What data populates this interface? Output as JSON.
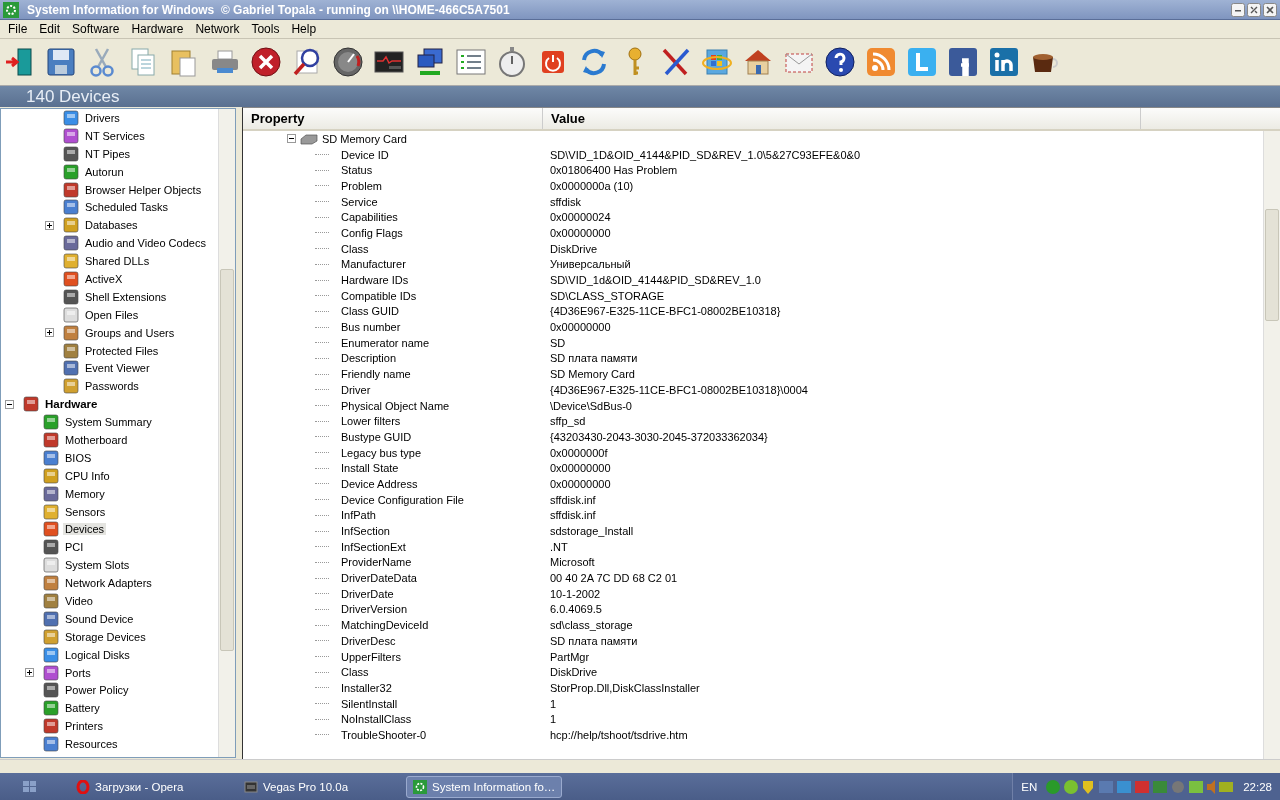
{
  "window": {
    "title": "System Information for Windows  © Gabriel Topala - running on \\\\HOME-466C5A7501"
  },
  "menu": [
    "File",
    "Edit",
    "Software",
    "Hardware",
    "Network",
    "Tools",
    "Help"
  ],
  "header": "140 Devices",
  "sidebar": {
    "items_above": [
      {
        "label": "Drivers",
        "kind": "leaf",
        "selected": false
      },
      {
        "label": "NT Services",
        "kind": "leaf",
        "selected": false
      },
      {
        "label": "NT Pipes",
        "kind": "leaf",
        "selected": false
      },
      {
        "label": "Autorun",
        "kind": "leaf",
        "selected": false
      },
      {
        "label": "Browser Helper Objects",
        "kind": "leaf",
        "selected": false
      },
      {
        "label": "Scheduled Tasks",
        "kind": "leaf",
        "selected": false
      },
      {
        "label": "Databases",
        "kind": "branch",
        "expanded": false,
        "selected": false
      },
      {
        "label": "Audio and Video Codecs",
        "kind": "leaf",
        "selected": false
      },
      {
        "label": "Shared DLLs",
        "kind": "leaf",
        "selected": false
      },
      {
        "label": "ActiveX",
        "kind": "leaf",
        "selected": false
      },
      {
        "label": "Shell Extensions",
        "kind": "leaf",
        "selected": false
      },
      {
        "label": "Open Files",
        "kind": "leaf",
        "selected": false
      },
      {
        "label": "Groups and Users",
        "kind": "branch",
        "expanded": false,
        "selected": false
      },
      {
        "label": "Protected Files",
        "kind": "leaf",
        "selected": false
      },
      {
        "label": "Event Viewer",
        "kind": "leaf",
        "selected": false
      },
      {
        "label": "Passwords",
        "kind": "leaf",
        "selected": false
      }
    ],
    "nodes": [
      {
        "label": "Hardware",
        "kind": "branch",
        "expanded": true,
        "selected": false,
        "children": [
          {
            "label": "System Summary",
            "kind": "leaf",
            "selected": false
          },
          {
            "label": "Motherboard",
            "kind": "leaf",
            "selected": false
          },
          {
            "label": "BIOS",
            "kind": "leaf",
            "selected": false
          },
          {
            "label": "CPU Info",
            "kind": "leaf",
            "selected": false
          },
          {
            "label": "Memory",
            "kind": "leaf",
            "selected": false
          },
          {
            "label": "Sensors",
            "kind": "leaf",
            "selected": false
          },
          {
            "label": "Devices",
            "kind": "leaf",
            "selected": true
          },
          {
            "label": "PCI",
            "kind": "leaf",
            "selected": false
          },
          {
            "label": "System Slots",
            "kind": "leaf",
            "selected": false
          },
          {
            "label": "Network Adapters",
            "kind": "leaf",
            "selected": false
          },
          {
            "label": "Video",
            "kind": "leaf",
            "selected": false
          },
          {
            "label": "Sound Device",
            "kind": "leaf",
            "selected": false
          },
          {
            "label": "Storage Devices",
            "kind": "leaf",
            "selected": false
          },
          {
            "label": "Logical Disks",
            "kind": "leaf",
            "selected": false
          },
          {
            "label": "Ports",
            "kind": "branch",
            "expanded": false,
            "selected": false
          },
          {
            "label": "Power Policy",
            "kind": "leaf",
            "selected": false
          },
          {
            "label": "Battery",
            "kind": "leaf",
            "selected": false
          },
          {
            "label": "Printers",
            "kind": "leaf",
            "selected": false
          },
          {
            "label": "Resources",
            "kind": "leaf",
            "selected": false
          }
        ]
      }
    ]
  },
  "table": {
    "columns": [
      "Property",
      "Value"
    ],
    "group": {
      "label": "SD Memory Card",
      "expanded": true,
      "rows": [
        {
          "property": "Device ID",
          "value": "SD\\VID_1D&OID_4144&PID_SD&REV_1.0\\5&27C93EFE&0&0"
        },
        {
          "property": "Status",
          "value": "0x01806400 Has Problem"
        },
        {
          "property": "Problem",
          "value": "0x0000000a (10)"
        },
        {
          "property": "Service",
          "value": "sffdisk"
        },
        {
          "property": "Capabilities",
          "value": "0x00000024"
        },
        {
          "property": "Config Flags",
          "value": "0x00000000"
        },
        {
          "property": "Class",
          "value": "DiskDrive"
        },
        {
          "property": "Manufacturer",
          "value": "Универсальный"
        },
        {
          "property": "Hardware IDs",
          "value": "SD\\VID_1d&OID_4144&PID_SD&REV_1.0"
        },
        {
          "property": "Compatible IDs",
          "value": "SD\\CLASS_STORAGE"
        },
        {
          "property": "Class GUID",
          "value": "{4D36E967-E325-11CE-BFC1-08002BE10318}"
        },
        {
          "property": "Bus number",
          "value": "0x00000000"
        },
        {
          "property": "Enumerator name",
          "value": "SD"
        },
        {
          "property": "Description",
          "value": "SD плата памяти"
        },
        {
          "property": "Friendly name",
          "value": "SD Memory Card"
        },
        {
          "property": "Driver",
          "value": "{4D36E967-E325-11CE-BFC1-08002BE10318}\\0004"
        },
        {
          "property": "Physical Object Name",
          "value": "\\Device\\SdBus-0"
        },
        {
          "property": "Lower filters",
          "value": "sffp_sd"
        },
        {
          "property": "Bustype GUID",
          "value": "{43203430-2043-3030-2045-372033362034}"
        },
        {
          "property": "Legacy bus type",
          "value": "0x0000000f"
        },
        {
          "property": "Install State",
          "value": "0x00000000"
        },
        {
          "property": "Device Address",
          "value": "0x00000000"
        },
        {
          "property": "Device Configuration File",
          "value": "sffdisk.inf"
        },
        {
          "property": "InfPath",
          "value": "sffdisk.inf"
        },
        {
          "property": "InfSection",
          "value": "sdstorage_Install"
        },
        {
          "property": "InfSectionExt",
          "value": ".NT"
        },
        {
          "property": "ProviderName",
          "value": "Microsoft"
        },
        {
          "property": "DriverDateData",
          "value": "00 40 2A 7C DD 68 C2 01"
        },
        {
          "property": "DriverDate",
          "value": "10-1-2002"
        },
        {
          "property": "DriverVersion",
          "value": "6.0.4069.5"
        },
        {
          "property": "MatchingDeviceId",
          "value": "sd\\class_storage"
        },
        {
          "property": "DriverDesc",
          "value": "SD плата памяти"
        },
        {
          "property": "UpperFilters",
          "value": "PartMgr"
        },
        {
          "property": "Class",
          "value": "DiskDrive"
        },
        {
          "property": "Installer32",
          "value": "StorProp.Dll,DiskClassInstaller"
        },
        {
          "property": "SilentInstall",
          "value": "1"
        },
        {
          "property": "NoInstallClass",
          "value": "1"
        },
        {
          "property": "TroubleShooter-0",
          "value": "hcp://help/tshoot/tsdrive.htm"
        }
      ]
    }
  },
  "taskbar": {
    "tasks": [
      {
        "label": "Загрузки - Opera",
        "kind": "browser",
        "selected": false
      },
      {
        "label": "Vegas Pro 10.0a",
        "kind": "editor",
        "selected": false
      },
      {
        "label": "System Information fo…",
        "kind": "sysinfo",
        "selected": true
      }
    ],
    "language": "EN",
    "clock": "22:28"
  }
}
